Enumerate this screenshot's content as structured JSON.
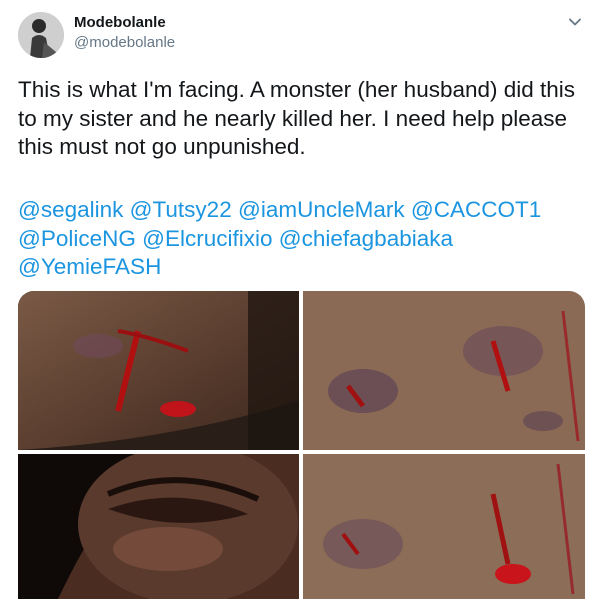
{
  "tweet": {
    "author_name": "Modebolanle",
    "author_handle": "@modebolanle",
    "body_lines": [
      "This is what I'm facing. A monster (her husband) did this",
      "to my sister and he nearly killed her. I need help please",
      "this must not go unpunished."
    ],
    "mention_lines": [
      [
        "@segalink",
        "@Tutsy22",
        "@iamUncleMark",
        "@CACCOT1"
      ],
      [
        "@PoliceNG",
        "@Elcrucifixio",
        "@chiefagbabiaka"
      ],
      [
        "@YemieFASH"
      ]
    ],
    "icons": {
      "menu": "chevron-down-icon"
    },
    "colors": {
      "link": "#1b95e0",
      "text": "#14171a",
      "secondary": "#657786"
    }
  }
}
